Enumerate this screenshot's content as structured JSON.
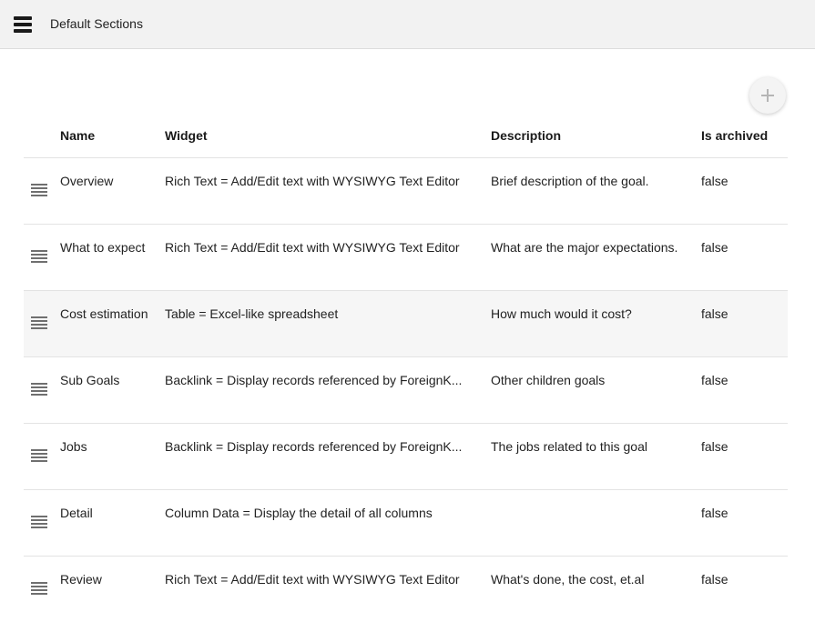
{
  "header": {
    "title": "Default Sections",
    "menu_icon": "menu-icon"
  },
  "actions": {
    "add_icon": "plus-icon"
  },
  "table": {
    "columns": {
      "name": "Name",
      "widget": "Widget",
      "description": "Description",
      "is_archived": "Is archived"
    },
    "rows": [
      {
        "name": "Overview",
        "widget": "Rich Text = Add/Edit text with WYSIWYG Text Editor",
        "description": "Brief description of the goal.",
        "is_archived": "false"
      },
      {
        "name": "What to expect",
        "widget": "Rich Text = Add/Edit text with WYSIWYG Text Editor",
        "description": "What are the major expectations.",
        "is_archived": "false"
      },
      {
        "name": "Cost estimation",
        "widget": "Table = Excel-like spreadsheet",
        "description": "How much would it cost?",
        "is_archived": "false"
      },
      {
        "name": "Sub Goals",
        "widget": "Backlink = Display records referenced by ForeignK...",
        "description": "Other children goals",
        "is_archived": "false"
      },
      {
        "name": "Jobs",
        "widget": "Backlink = Display records referenced by ForeignK...",
        "description": "The jobs related to this goal",
        "is_archived": "false"
      },
      {
        "name": "Detail",
        "widget": "Column Data = Display the detail of all columns",
        "description": "",
        "is_archived": "false"
      },
      {
        "name": "Review",
        "widget": "Rich Text = Add/Edit text with WYSIWYG Text Editor",
        "description": "What's done, the cost, et.al",
        "is_archived": "false"
      }
    ]
  },
  "colors": {
    "topbar_bg": "#f2f2f2",
    "row_highlight": "#f6f6f6",
    "divider": "#e3e3e3"
  }
}
